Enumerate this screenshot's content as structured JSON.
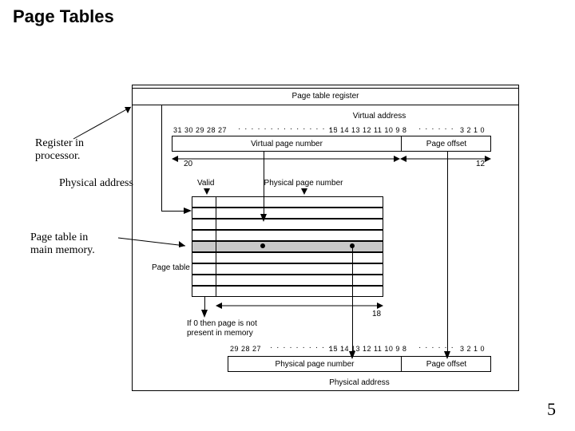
{
  "title": "Page Tables",
  "annotations": {
    "register": "Register in\nprocessor.",
    "physical_addr": "Physical address",
    "page_table_mem": "Page table in\nmain memory."
  },
  "slide_number": "5",
  "diagram": {
    "page_table_register_label": "Page table register",
    "virtual_address_label": "Virtual address",
    "physical_address_label": "Physical address",
    "vpn_label": "Virtual page number",
    "page_offset_label": "Page offset",
    "ppn_label": "Physical page number",
    "valid_label": "Valid",
    "page_table_label": "Page table",
    "if_zero_label": "If 0 then page is not\npresent in memory",
    "vpn_bits_width": "20",
    "offset_bits_width": "12",
    "ppn_bits_width": "18",
    "bit_row_top": {
      "left_group": "31 30 29 28 27",
      "right_group_a": "15 14 13 12 11 10 9 8",
      "right_group_b": "3 2 1 0"
    },
    "bit_row_bottom": {
      "left_group": "29 28 27",
      "right_group_a": "15 14 13 12 11 10 9 8",
      "right_group_b": "3 2 1 0"
    }
  }
}
